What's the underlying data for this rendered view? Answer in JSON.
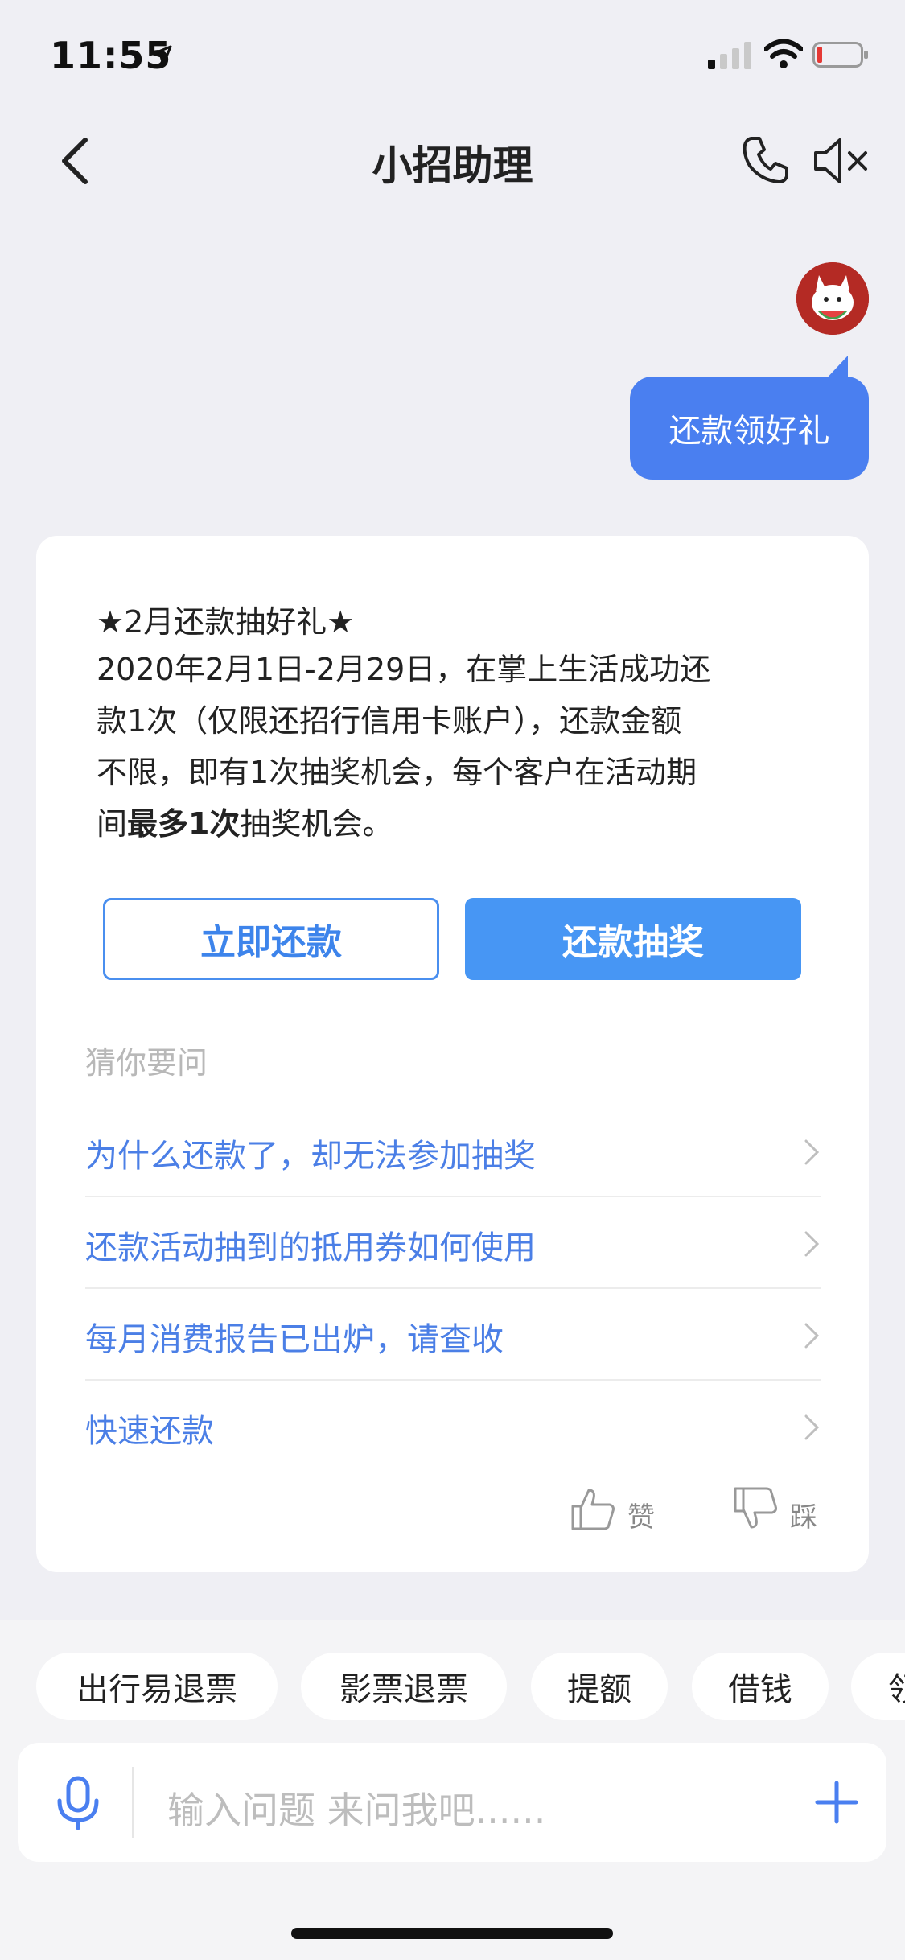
{
  "status_bar": {
    "time": "11:55"
  },
  "nav": {
    "title": "小招助理"
  },
  "chat": {
    "user_message": "还款领好礼",
    "card": {
      "title": "★2月还款抽好礼★",
      "body_line1": "2020年2月1日-2月29日，在掌上生活成功还",
      "body_line2": "款1次（仅限还招行信用卡账户），还款金额",
      "body_line3": "不限，即有1次抽奖机会，每个客户在活动期",
      "body_line4_a": "间",
      "body_line4_bold": "最多1次",
      "body_line4_b": "抽奖机会。",
      "btn_pay": "立即还款",
      "btn_lottery": "还款抽奖",
      "guess_label": "猜你要问",
      "questions": [
        "为什么还款了，却无法参加抽奖",
        "还款活动抽到的抵用券如何使用",
        "每月消费报告已出炉，请查收",
        "快速还款"
      ],
      "like_label": "赞",
      "dislike_label": "踩"
    }
  },
  "quick_chips": [
    "出行易退票",
    "影票退票",
    "提额",
    "借钱",
    "领"
  ],
  "input": {
    "placeholder": "输入问题 来问我吧......"
  },
  "colors": {
    "accent": "#4a7ff0",
    "link": "#4b7fe6",
    "button": "#4796f4"
  }
}
